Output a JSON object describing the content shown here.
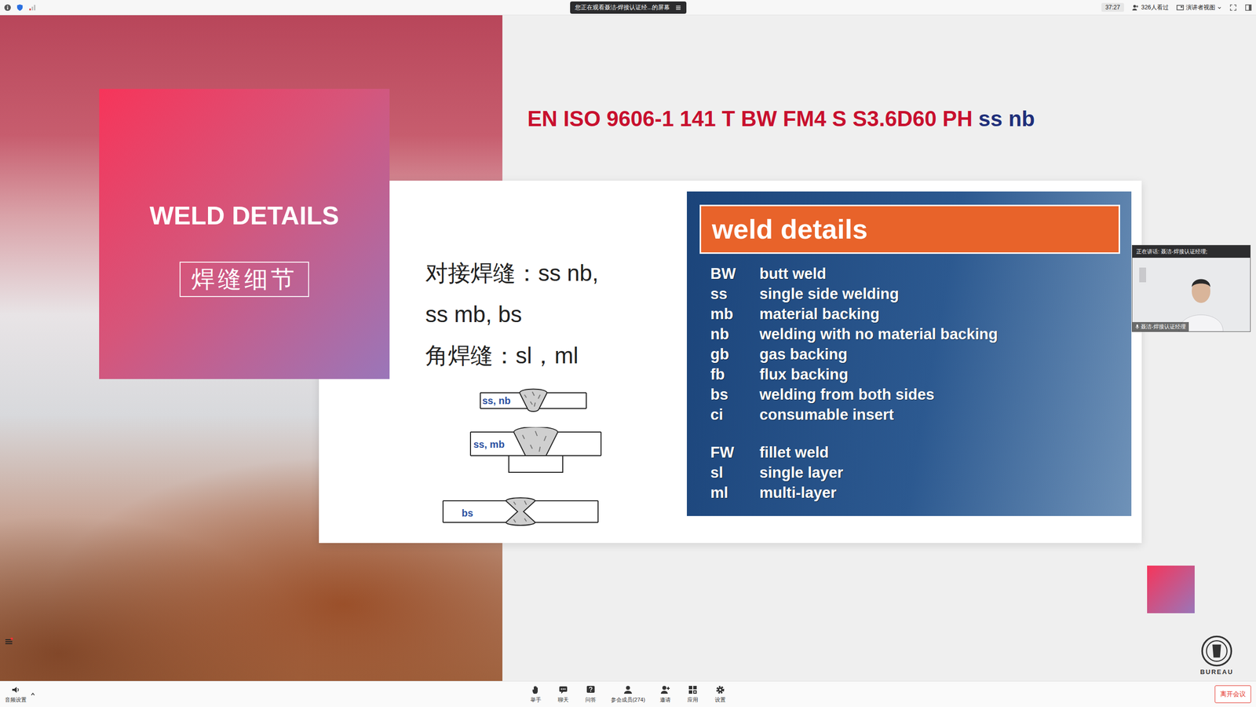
{
  "top_bar": {
    "banner": "您正在观看聂洁-焊接认证经...的屏幕",
    "timer": "37:27",
    "viewers": "326人看过",
    "view_mode": "演讲者视图"
  },
  "slide": {
    "section_title": "WELD DETAILS",
    "section_subtitle": "焊缝细节",
    "designation": "EN ISO 9606-1 141 T BW FM4 S S3.6D60 PH",
    "designation_highlight": "ss nb",
    "lines": [
      "对接焊缝：ss nb,",
      "ss mb, bs",
      "角焊缝：sl，ml"
    ],
    "diagrams": [
      {
        "label": "ss, nb",
        "kind": "nb"
      },
      {
        "label": "ss, mb",
        "kind": "mb"
      },
      {
        "label": "bs",
        "kind": "bs"
      }
    ],
    "legend": {
      "title": "weld details",
      "groups": [
        {
          "rows": [
            {
              "code": "BW",
              "meaning": "butt weld"
            },
            {
              "code": "ss",
              "meaning": "single side welding"
            },
            {
              "code": "mb",
              "meaning": "material backing"
            },
            {
              "code": "nb",
              "meaning": "welding with no material backing"
            },
            {
              "code": "gb",
              "meaning": "gas backing"
            },
            {
              "code": "fb",
              "meaning": "flux backing"
            },
            {
              "code": "bs",
              "meaning": "welding from both sides"
            },
            {
              "code": "ci",
              "meaning": "consumable insert"
            }
          ]
        },
        {
          "rows": [
            {
              "code": "FW",
              "meaning": "fillet weld"
            },
            {
              "code": "sl",
              "meaning": "single layer"
            },
            {
              "code": "ml",
              "meaning": "multi-layer"
            }
          ]
        }
      ]
    },
    "logo_text": "BUREAU"
  },
  "speaker": {
    "speaking": "正在讲话: 聂洁-焊接认证经理;",
    "name": "聂洁-焊接认证经理"
  },
  "toolbar": {
    "audio": "音频设置",
    "buttons": [
      {
        "label": "举手",
        "kind": "hand"
      },
      {
        "label": "聊天",
        "kind": "chat"
      },
      {
        "label": "问答",
        "kind": "qa"
      },
      {
        "label": "参会成员(274)",
        "kind": "members"
      },
      {
        "label": "邀请",
        "kind": "invite"
      },
      {
        "label": "应用",
        "kind": "apps"
      },
      {
        "label": "设置",
        "kind": "settings"
      }
    ],
    "leave": "离开会议"
  }
}
